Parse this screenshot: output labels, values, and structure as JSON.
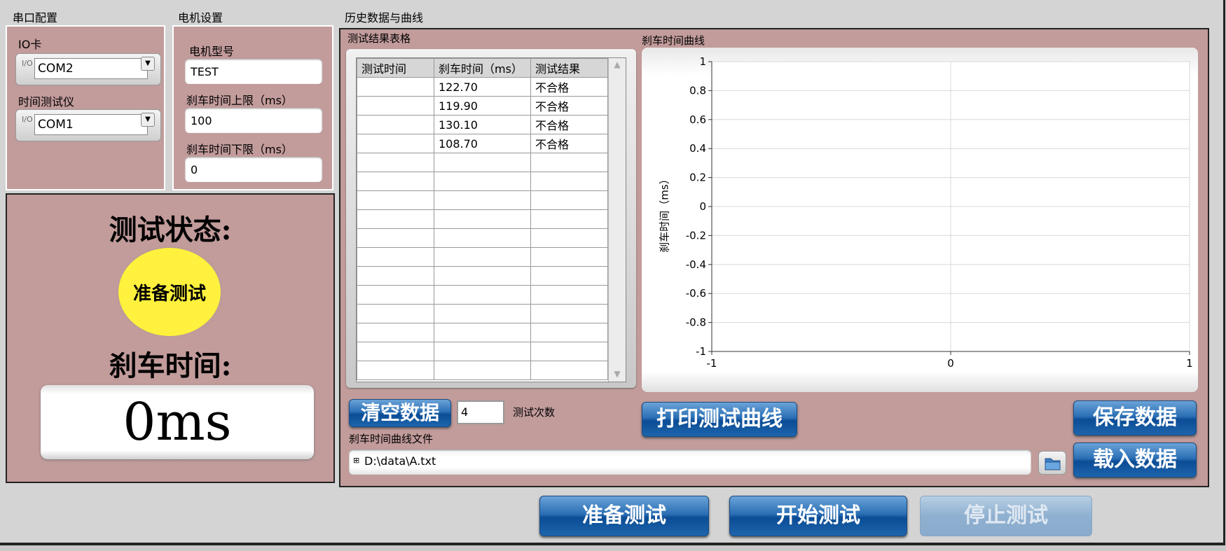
{
  "serial": {
    "title": "串口配置",
    "io_label": "IO卡",
    "io_value": "COM2",
    "timer_label": "时间测试仪",
    "timer_value": "COM1",
    "io_badge": "I/O"
  },
  "motor": {
    "title": "电机设置",
    "model_label": "电机型号",
    "model_value": "TEST",
    "upper_label": "刹车时间上限（ms）",
    "upper_value": "100",
    "lower_label": "刹车时间下限（ms）",
    "lower_value": "0"
  },
  "status": {
    "title": "测试状态:",
    "indicator": "准备测试",
    "indicator_color": "#fff13d",
    "brake_title": "刹车时间:",
    "brake_value": "0ms"
  },
  "history": {
    "title": "历史数据与曲线",
    "table_title": "测试结果表格",
    "chart_title": "刹车时间曲线",
    "columns": [
      "测试时间",
      "刹车时间（ms）",
      "测试结果"
    ],
    "rows": [
      [
        "",
        "122.70",
        "不合格"
      ],
      [
        "",
        "119.90",
        "不合格"
      ],
      [
        "",
        "130.10",
        "不合格"
      ],
      [
        "",
        "108.70",
        "不合格"
      ]
    ],
    "clear_button": "清空数据",
    "count_value": "4",
    "count_label": "测试次数",
    "print_button": "打印测试曲线",
    "save_button": "保存数据",
    "load_button": "载入数据",
    "file_label": "刹车时间曲线文件",
    "file_path": "D:\\data\\A.txt"
  },
  "actions": {
    "prepare": "准备测试",
    "start": "开始测试",
    "stop": "停止测试"
  },
  "chart_data": {
    "type": "line",
    "ylabel": "刹车时间（ms）",
    "xlabel": "",
    "xlim": [
      -1,
      1
    ],
    "ylim": [
      -1,
      1
    ],
    "x_ticks": [
      "-1",
      "0",
      "1"
    ],
    "y_ticks": [
      "1",
      "0.8",
      "0.6",
      "0.4",
      "0.2",
      "0",
      "-0.2",
      "-0.4",
      "-0.6",
      "-0.8",
      "-1"
    ],
    "grid": true,
    "series": []
  },
  "colors": {
    "panel_pink": "#c29b9b",
    "button_blue": "#1d65ad",
    "background": "#d4d4d4"
  }
}
